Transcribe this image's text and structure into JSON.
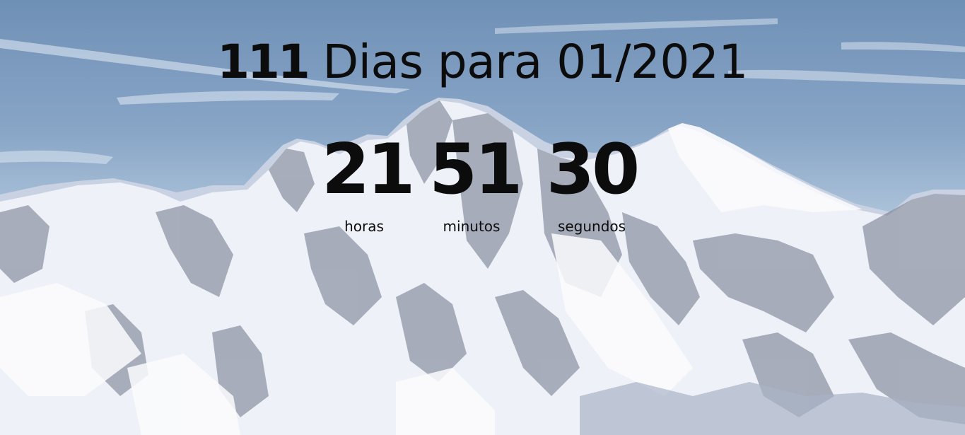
{
  "countdown": {
    "days": "111",
    "title_rest": "Dias para 01/2021",
    "hours": {
      "value": "21",
      "label": "horas"
    },
    "minutes": {
      "value": "51",
      "label": "minutos"
    },
    "seconds": {
      "value": "30",
      "label": "segundos"
    }
  },
  "background": {
    "description_icon": "snowy-mountain-background",
    "sky_color": "#7f9ec2",
    "snow_color": "#f4f6fa",
    "rock_color": "#5b6478"
  }
}
